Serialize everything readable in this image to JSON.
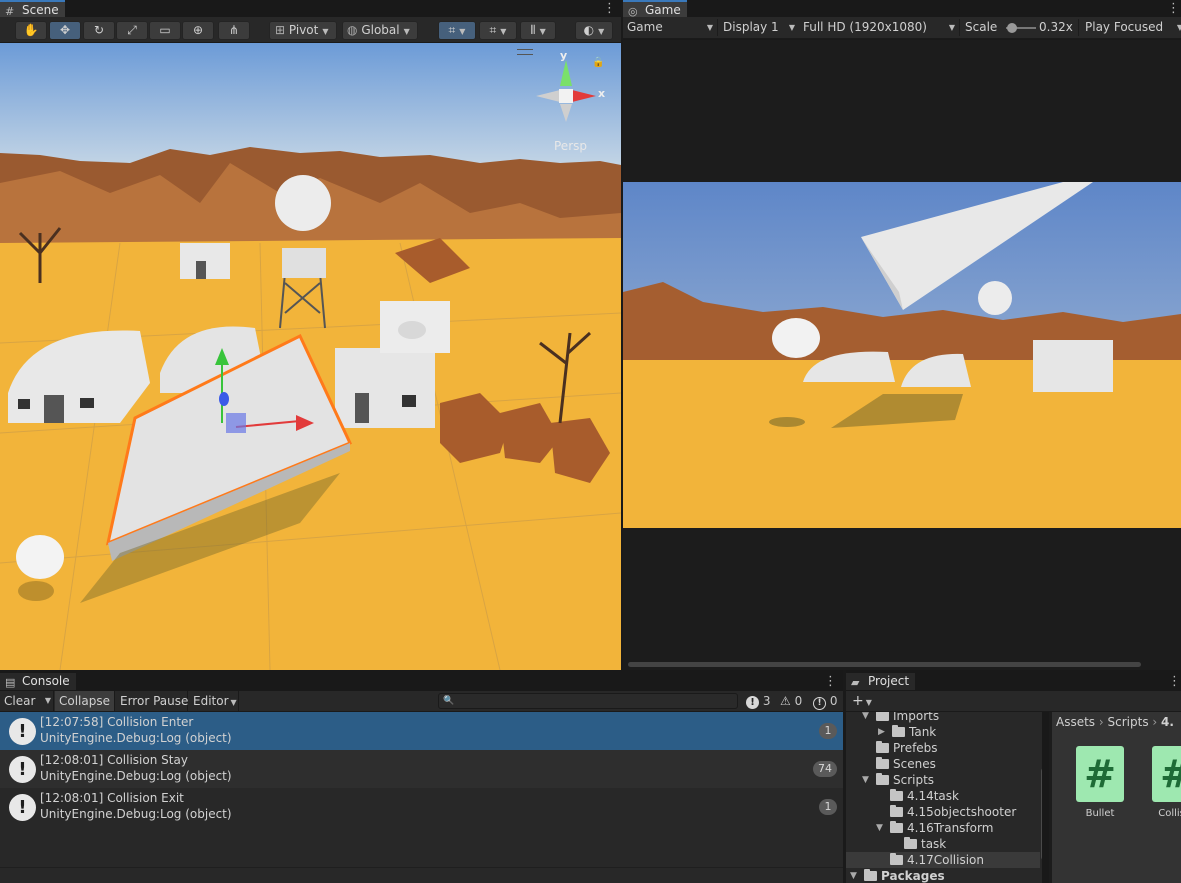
{
  "scene_tab": {
    "title": "Scene"
  },
  "scene_toolbar": {
    "pivot_label": "Pivot",
    "global_label": "Global",
    "persp_label": "Persp",
    "gizmo_x": "x",
    "gizmo_y": "y"
  },
  "game_tab": {
    "title": "Game"
  },
  "game_toolbar": {
    "mode": "Game",
    "display": "Display 1",
    "resolution": "Full HD (1920x1080)",
    "scale_label": "Scale",
    "scale_value": "0.32x",
    "play_mode": "Play Focused"
  },
  "console": {
    "tab_title": "Console",
    "clear_label": "Clear",
    "collapse_label": "Collapse",
    "error_pause_label": "Error Pause",
    "editor_label": "Editor",
    "search_placeholder": "",
    "info_count": "3",
    "warning_count": "0",
    "error_count": "0",
    "entries": [
      {
        "line1": "[12:07:58] Collision Enter",
        "line2": "UnityEngine.Debug:Log (object)",
        "count": "1"
      },
      {
        "line1": "[12:08:01] Collision Stay",
        "line2": "UnityEngine.Debug:Log (object)",
        "count": "74"
      },
      {
        "line1": "[12:08:01] Collision Exit",
        "line2": "UnityEngine.Debug:Log (object)",
        "count": "1"
      }
    ]
  },
  "project": {
    "tab_title": "Project",
    "add_label": "+",
    "tree": [
      {
        "label": "Imports"
      },
      {
        "label": "Tank"
      },
      {
        "label": "Prefebs"
      },
      {
        "label": "Scenes"
      },
      {
        "label": "Scripts"
      },
      {
        "label": "4.14task"
      },
      {
        "label": "4.15objectshooter"
      },
      {
        "label": "4.16Transform"
      },
      {
        "label": "task"
      },
      {
        "label": "4.17Collision"
      },
      {
        "label": "Packages"
      }
    ],
    "breadcrumb": [
      "Assets",
      "Scripts",
      "4."
    ],
    "assets": [
      {
        "name": "Bullet",
        "icon": "#"
      },
      {
        "name": "Collisio",
        "icon": "#"
      }
    ]
  },
  "colors": {
    "selection": "#2c5d87",
    "tab_accent": "#3a79bb",
    "sand": "#f2b43a",
    "sky_top": "#6b9bd6",
    "script_icon": "#9ee8b0"
  }
}
